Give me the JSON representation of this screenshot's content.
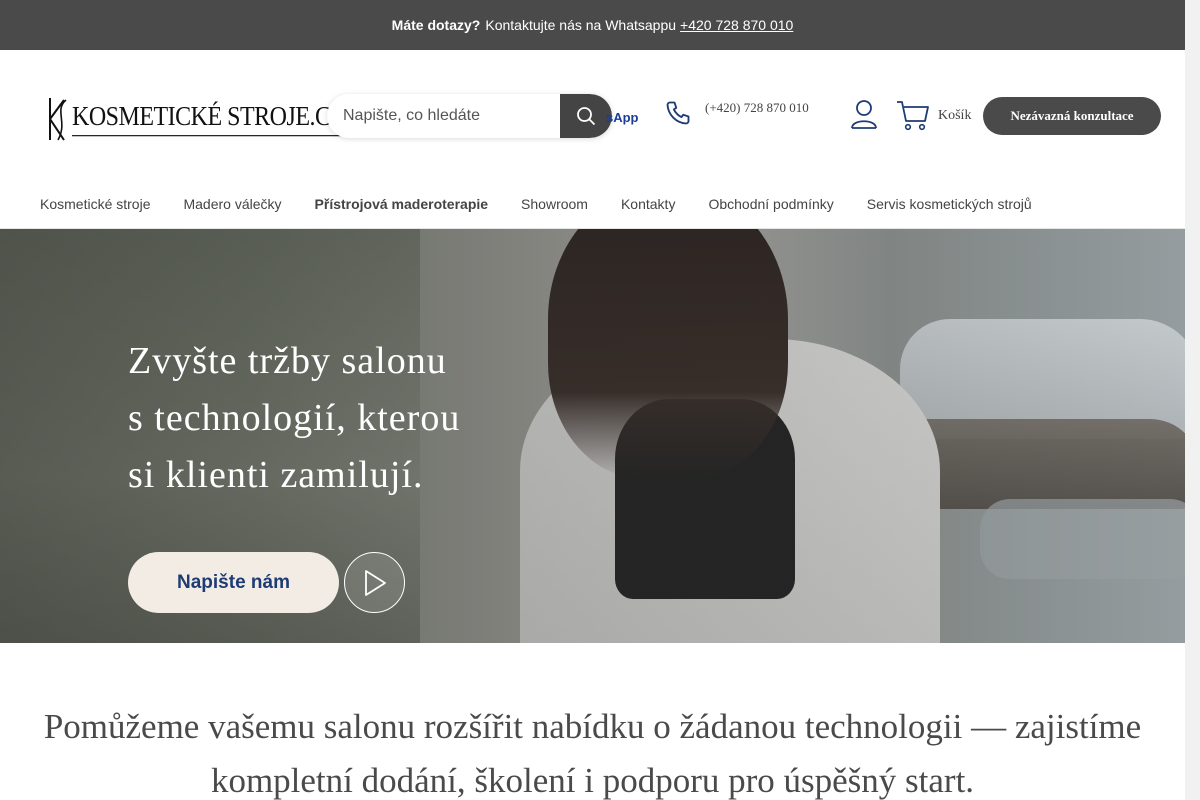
{
  "topbar": {
    "bold": "Máte dotazy?",
    "text": "Kontaktujte nás na Whatsappu",
    "phone_link": "+420 728 870 010"
  },
  "header": {
    "logo_text": "KOSMETICKÉ STROJE.CZ",
    "search_placeholder": "Napište, co hledáte",
    "whatsapp_partial": "sApp",
    "phone": "(+420) 728 870 010",
    "cart_label": "Košík",
    "cta_label": "Nezávazná konzultace"
  },
  "nav": {
    "items": [
      {
        "label": "Kosmetické stroje",
        "active": false
      },
      {
        "label": "Madero válečky",
        "active": false
      },
      {
        "label": "Přístrojová maderoterapie",
        "active": true
      },
      {
        "label": "Showroom",
        "active": false
      },
      {
        "label": "Kontakty",
        "active": false
      },
      {
        "label": "Obchodní podmínky",
        "active": false
      },
      {
        "label": "Servis kosmetických strojů",
        "active": false
      }
    ]
  },
  "hero": {
    "line1": "Zvyšte tržby salonu",
    "line2": "s technologií, kterou",
    "line3": "si klienti zamilují.",
    "button_label": "Napište nám",
    "play_icon": "play-icon"
  },
  "tagline": {
    "line1": "Pomůžeme vašemu salonu rozšířit nabídku o žádanou technologii — zajistíme",
    "line2": "kompletní dodání, školení i podporu pro úspěšný start."
  },
  "colors": {
    "topbar_bg": "#4a4a4a",
    "cta_bg": "#4a4a4a",
    "hero_button_bg": "#f3ece4",
    "hero_button_text": "#1f3b73",
    "whatsapp_blue": "#1a3d9a"
  }
}
